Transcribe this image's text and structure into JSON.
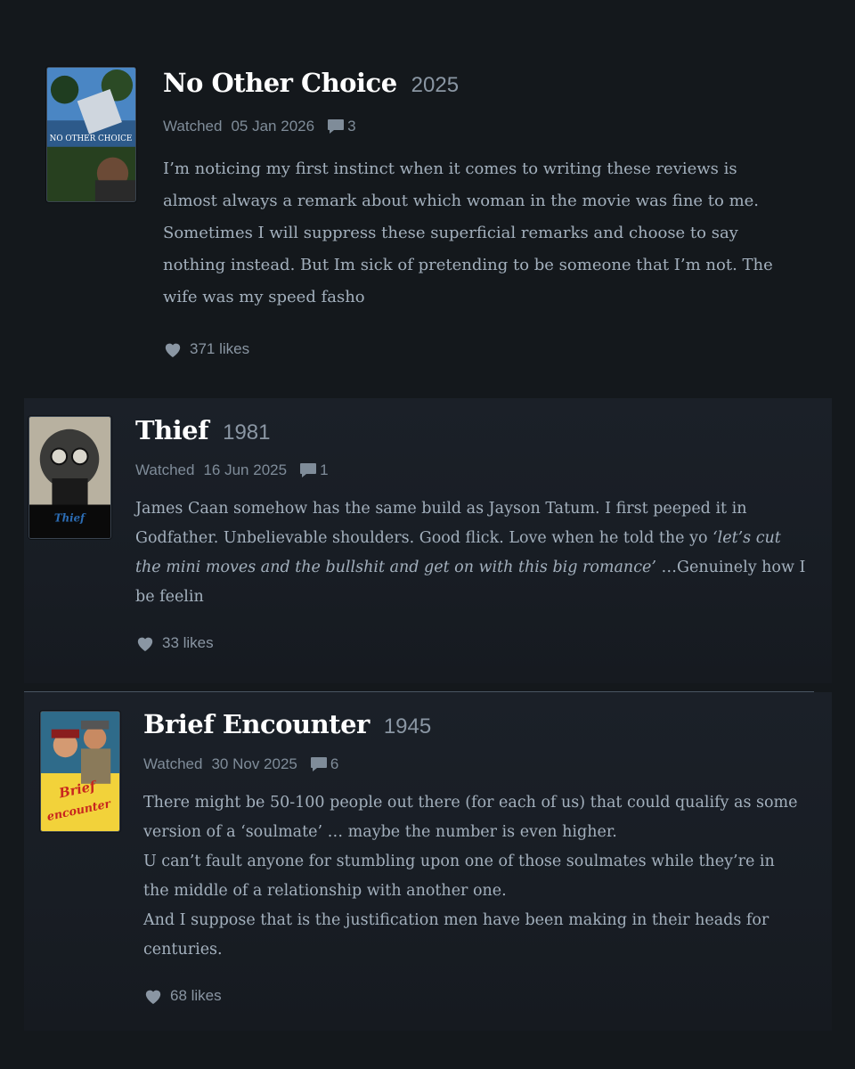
{
  "reviews": [
    {
      "title": "No Other Choice",
      "year": "2025",
      "watched_label": "Watched",
      "watched_date": "05 Jan 2026",
      "comment_count": "3",
      "poster_text": "NO OTHER CHOICE",
      "body_lines": [
        "I’m noticing my first instinct when it comes to writing these reviews is",
        "almost always a remark about which woman in the movie was fine to me.",
        "Sometimes I will suppress these superficial remarks and choose to say",
        "nothing instead. But Im sick of pretending to be someone that I’m not. The",
        "wife was my speed fasho"
      ],
      "likes": "371 likes"
    },
    {
      "title": "Thief",
      "year": "1981",
      "watched_label": "Watched",
      "watched_date": "16 Jun 2025",
      "comment_count": "1",
      "poster_text": "Thief",
      "body_line1": "James Caan somehow has the same build as Jayson Tatum. I first peeped it in",
      "body_line2_pre": "Godfather. Unbelievable shoulders. Good flick. Love when he told the yo ",
      "body_line2_quote": "‘let’s cut",
      "body_line3_quote": "the mini moves and the bullshit and get on with this big romance’",
      "body_line3_post": " …Genuinely how I",
      "body_line4": "be feelin",
      "likes": "33 likes"
    },
    {
      "title": "Brief Encounter",
      "year": "1945",
      "watched_label": "Watched",
      "watched_date": "30 Nov 2025",
      "comment_count": "6",
      "poster_text_1": "Brief",
      "poster_text_2": "encounter",
      "body_lines": [
        "There might be 50-100 people out there (for each of us) that could qualify as some",
        "version of a ‘soulmate’ … maybe the number is even higher.",
        "U can’t fault anyone for stumbling upon one of those soulmates while they’re in",
        "the middle of a relationship with another one.",
        "And I suppose that is the justification men have been making in their heads for",
        "centuries."
      ],
      "likes": "68 likes"
    }
  ],
  "colors": {
    "background": "#14181c",
    "title": "#ffffff",
    "meta": "#7f8c99",
    "body": "#a3b0bd"
  },
  "icons": [
    "comment-icon",
    "heart-icon"
  ]
}
